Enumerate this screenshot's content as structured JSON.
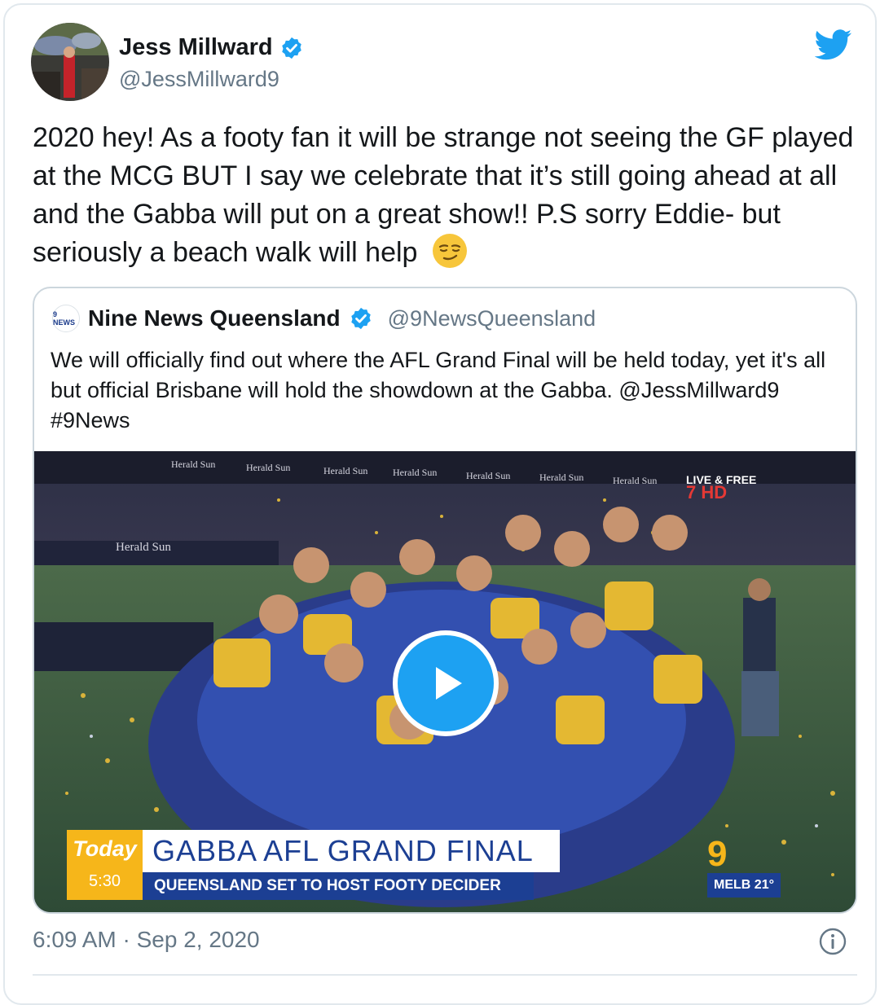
{
  "tweet": {
    "author_name": "Jess Millward",
    "author_handle": "@JessMillward9",
    "text": "2020 hey! As a footy fan it will be strange not seeing the GF played at the MCG BUT I say we celebrate that it’s still going ahead at all and the Gabba will put on a great show!! P.S sorry Eddie- but seriously a beach walk will help",
    "emoji": "smirking-face",
    "timestamp": "6:09 AM · Sep 2, 2020"
  },
  "quoted": {
    "logo_text": "9 NEWS",
    "name": "Nine News Queensland",
    "handle": "@9NewsQueensland",
    "text": "We will officially find out where the AFL Grand Final will be held today, yet it's all but official Brisbane will hold the showdown at the Gabba. @JessMillward9 #9News",
    "video": {
      "overlay_program": "Today",
      "overlay_time": "5:30",
      "headline": "GABBA AFL GRAND FINAL",
      "subheadline": "QUEENSLAND SET TO HOST FOOTY DECIDER",
      "channel_logo": "9",
      "weather": "MELB 21°",
      "corner_text": "LIVE & FREE",
      "corner_badge": "7 HD",
      "signage_text": "Herald Sun"
    }
  },
  "colors": {
    "twitter_blue": "#1da1f2",
    "verified_blue": "#1da1f2",
    "text_primary": "#14171a",
    "text_secondary": "#657786",
    "border": "#e1e8ed",
    "broadcast_blue": "#1c3f93",
    "broadcast_gold": "#f6b61a"
  },
  "icons": [
    "twitter-bird-icon",
    "verified-badge-icon",
    "play-icon",
    "info-icon"
  ]
}
